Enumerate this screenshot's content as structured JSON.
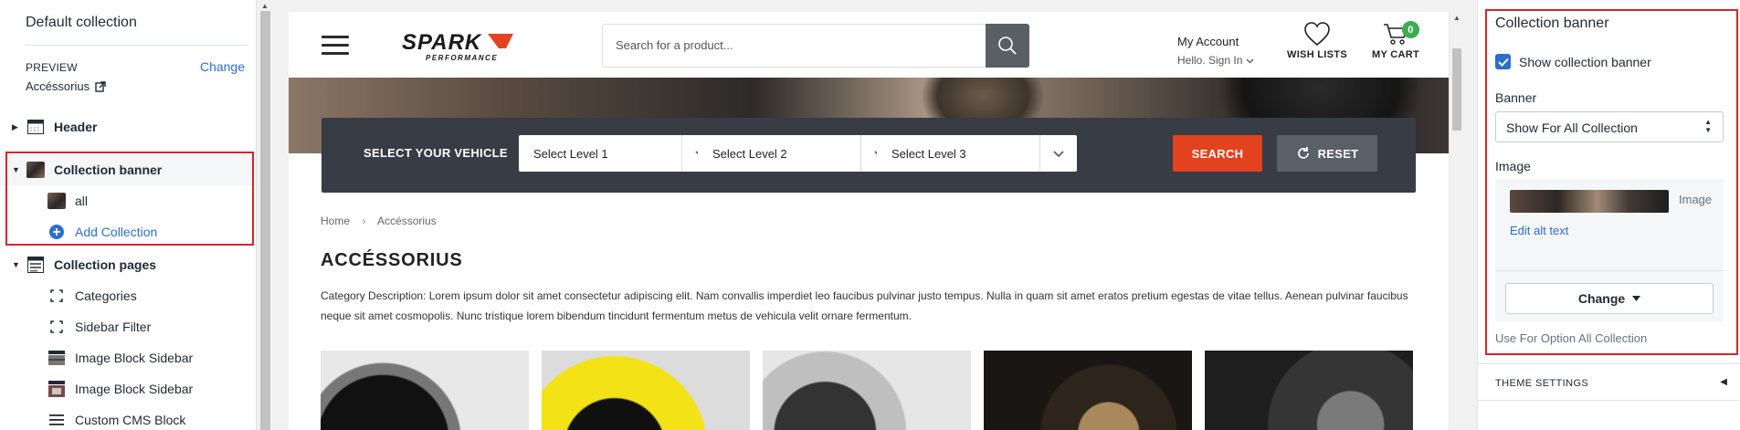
{
  "sidebar": {
    "title": "Default collection",
    "preview_label": "PREVIEW",
    "change_label": "Change",
    "preview_value": "Accéssorius",
    "header_label": "Header",
    "collection_banner_label": "Collection banner",
    "banner_child_label": "all",
    "add_collection_label": "Add Collection",
    "collection_pages_label": "Collection pages",
    "pages": [
      "Categories",
      "Sidebar Filter",
      "Image Block Sidebar",
      "Image Block Sidebar",
      "Custom CMS Block"
    ]
  },
  "store": {
    "search_placeholder": "Search for a product...",
    "account_title": "My Account",
    "account_sub": "Hello. Sign In",
    "wish_label": "WISH LISTS",
    "cart_label": "MY CART",
    "cart_count": "0",
    "logo_text": "SPARK",
    "logo_sub": "PERFORMANCE",
    "vehicle_title": "SELECT YOUR VEHICLE",
    "level1": "Select Level 1",
    "level2": "Select Level 2",
    "level3": "Select Level 3",
    "search_btn": "SEARCH",
    "reset_btn": "RESET",
    "breadcrumb_home": "Home",
    "breadcrumb_current": "Accéssorius",
    "page_title": "ACCÉSSORIUS",
    "description": "Category Description: Lorem ipsum dolor sit amet consectetur adipiscing elit. Nam convallis imperdiet leo faucibus pulvinar justo tempus. Nulla in quam sit amet eratos pretium egestas de vitae tellus. Aenean pulvinar faucibus neque sit amet cosmopolis. Nunc tristique lorem bibendum tincidunt fermentum metus de vehicula velit ornare fermentum."
  },
  "panel": {
    "title": "Collection banner",
    "show_banner_label": "Show collection banner",
    "show_banner_checked": true,
    "banner_label": "Banner",
    "banner_value": "Show For All Collection",
    "image_label": "Image",
    "image_thumb_label": "Image",
    "edit_alt_label": "Edit alt text",
    "change_label": "Change",
    "help_text": "Use For Option All Collection",
    "theme_settings_label": "THEME SETTINGS"
  },
  "colors": {
    "accent_link": "#2c6ecb",
    "highlight_border": "#d5262b",
    "search_button": "#e2431e",
    "cart_badge": "#3bad52"
  }
}
